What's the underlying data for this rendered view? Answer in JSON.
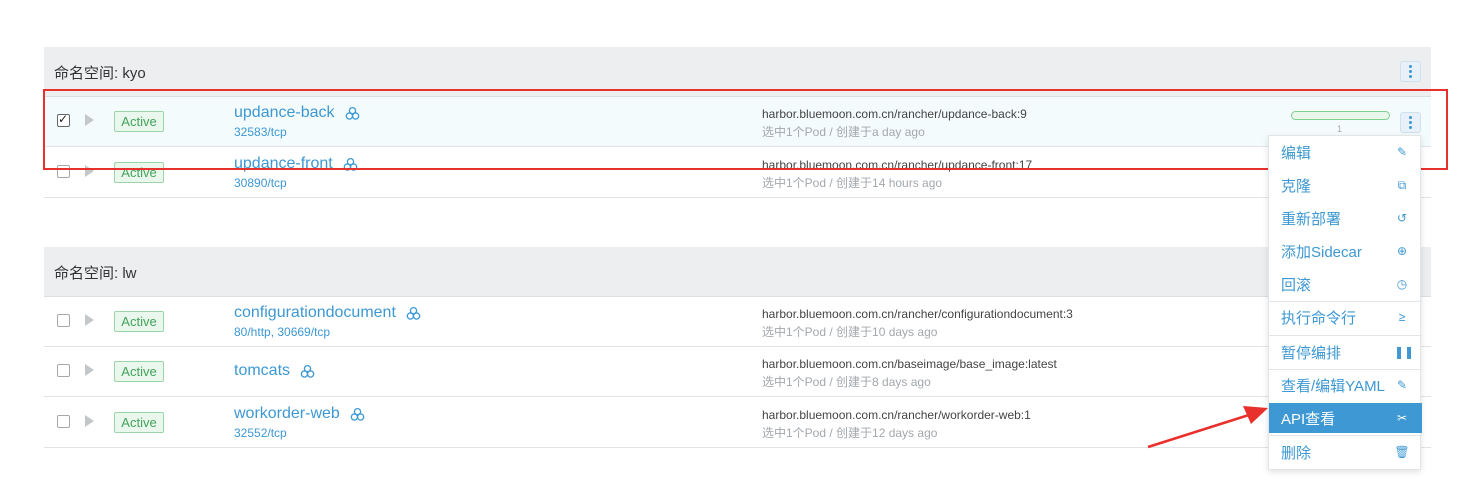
{
  "namespaces": [
    {
      "title": "命名空间: kyo",
      "rows": [
        {
          "checked": true,
          "status": "Active",
          "name": "updance-back",
          "ports": "32583/tcp",
          "image": "harbor.bluemoon.com.cn/rancher/updance-back:9",
          "meta": "选中1个Pod / 创建于a day ago",
          "pods": "1"
        },
        {
          "checked": false,
          "status": "Active",
          "name": "updance-front",
          "ports": "30890/tcp",
          "image": "harbor.bluemoon.com.cn/rancher/updance-front:17",
          "meta": "选中1个Pod / 创建于14 hours ago"
        }
      ]
    },
    {
      "title": "命名空间: lw",
      "rows": [
        {
          "checked": false,
          "status": "Active",
          "name": "configurationdocument",
          "ports": "80/http, 30669/tcp",
          "image": "harbor.bluemoon.com.cn/rancher/configurationdocument:3",
          "meta": "选中1个Pod / 创建于10 days ago"
        },
        {
          "checked": false,
          "status": "Active",
          "name": "tomcats",
          "ports": "",
          "image": "harbor.bluemoon.com.cn/baseimage/base_image:latest",
          "meta": "选中1个Pod / 创建于8 days ago"
        },
        {
          "checked": false,
          "status": "Active",
          "name": "workorder-web",
          "ports": "32552/tcp",
          "image": "harbor.bluemoon.com.cn/rancher/workorder-web:1",
          "meta": "选中1个Pod / 创建于12 days ago"
        }
      ]
    }
  ],
  "menu": {
    "items": [
      {
        "label": "编辑",
        "icon": "pencil-icon",
        "glyph": "✎"
      },
      {
        "label": "克隆",
        "icon": "clone-icon",
        "glyph": "⧉"
      },
      {
        "label": "重新部署",
        "icon": "redeploy-icon",
        "glyph": "↺"
      },
      {
        "label": "添加Sidecar",
        "icon": "add-circle-icon",
        "glyph": "⊕"
      },
      {
        "label": "回滚",
        "icon": "history-icon",
        "glyph": "◷"
      },
      {
        "label": "执行命令行",
        "icon": "terminal-icon",
        "glyph": "≥"
      },
      {
        "label": "暂停编排",
        "icon": "pause-icon",
        "glyph": "❚❚"
      },
      {
        "label": "查看/编辑YAML",
        "icon": "pencil-icon",
        "glyph": "✎"
      },
      {
        "label": "API查看",
        "icon": "api-icon",
        "glyph": "✂",
        "active": true
      },
      {
        "label": "删除",
        "icon": "trash-icon",
        "glyph": "🗑"
      }
    ]
  },
  "colors": {
    "accent": "#3d98d3",
    "annotation": "#e8302c",
    "active_badge": "#45a35b"
  }
}
